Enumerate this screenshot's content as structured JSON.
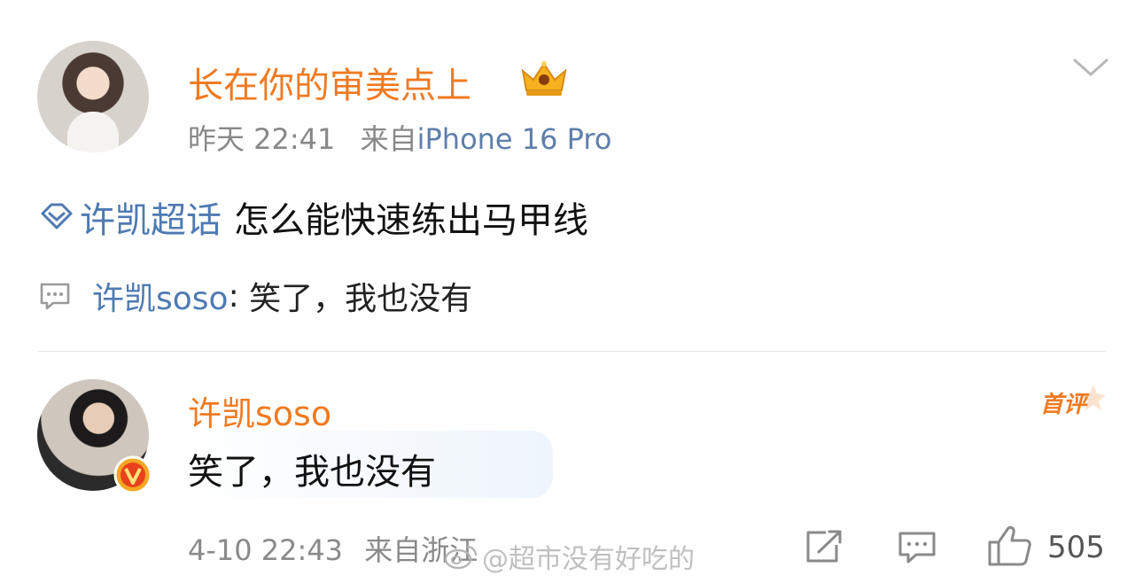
{
  "post": {
    "author": "长在你的审美点上",
    "time": "昨天 22:41",
    "source_prefix": "来自",
    "device": "iPhone 16 Pro",
    "topic": "许凯超话",
    "text": "怎么能快速练出马甲线",
    "icons": {
      "badge": "crown-icon",
      "menu": "chevron-down-icon",
      "topic": "supertopic-icon"
    }
  },
  "preview": {
    "user": "许凯soso",
    "separator": ": ",
    "text": "笑了，我也没有"
  },
  "comment": {
    "user": "许凯soso",
    "text": "笑了，我也没有",
    "badge": "首评",
    "time": "4-10 22:43",
    "location": "来自浙江",
    "likes": "505"
  },
  "watermark": {
    "text": "@超市没有好吃的"
  },
  "colors": {
    "username": "#f07a21",
    "link": "#4f7ab2",
    "meta": "#888888",
    "bubble": "#eef5fc"
  }
}
